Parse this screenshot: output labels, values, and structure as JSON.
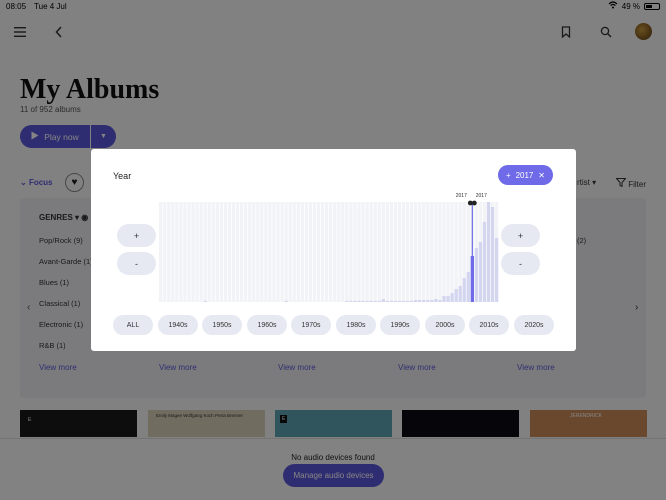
{
  "status": {
    "time": "08:05",
    "date": "Tue 4 Jul",
    "battery": "49 %",
    "battery_level": 0.49
  },
  "page": {
    "title": "My Albums",
    "subtitle": "11 of 952 albums",
    "play_label": "Play now",
    "focus_label": "Focus",
    "artist_label": "rtist",
    "filter_label": "Filter"
  },
  "genres": {
    "header": "GENRES",
    "items": [
      "Pop/Rock (9)",
      "Avant-Garde (1)",
      "Blues (1)",
      "Classical (1)",
      "Electronic (1)",
      "R&B (1)"
    ],
    "view_more": "View more",
    "right_count": "(2)"
  },
  "thumbs": [
    {
      "label": "E",
      "color": "#1a1a1a"
    },
    {
      "label": "Emily Magee  Wolfgang Koch  Petra Brenner",
      "color": "#d8cfb8"
    },
    {
      "label": "E",
      "color": "#5fa4b0"
    },
    {
      "label": "",
      "color": "#0a0a14"
    },
    {
      "label": "JERENDRICK",
      "color": "#c98a58"
    }
  ],
  "footer": {
    "no_audio": "No audio devices found",
    "manage": "Manage audio devices"
  },
  "modal": {
    "title": "Year",
    "chip": "2017",
    "range_start_label": "2017",
    "range_end_label": "2017",
    "plus": "+",
    "minus": "-",
    "decades": [
      "ALL",
      "1940s",
      "1950s",
      "1960s",
      "1970s",
      "1980s",
      "1990s",
      "2000s",
      "2010s",
      "2020s"
    ]
  },
  "chart_data": {
    "type": "bar",
    "x": [
      1940,
      1941,
      1942,
      1943,
      1944,
      1945,
      1946,
      1947,
      1948,
      1949,
      1950,
      1951,
      1952,
      1953,
      1954,
      1955,
      1956,
      1957,
      1958,
      1959,
      1960,
      1961,
      1962,
      1963,
      1964,
      1965,
      1966,
      1967,
      1968,
      1969,
      1970,
      1971,
      1972,
      1973,
      1974,
      1975,
      1976,
      1977,
      1978,
      1979,
      1980,
      1981,
      1982,
      1983,
      1984,
      1985,
      1986,
      1987,
      1988,
      1989,
      1990,
      1991,
      1992,
      1993,
      1994,
      1995,
      1996,
      1997,
      1998,
      1999,
      2000,
      2001,
      2002,
      2003,
      2004,
      2005,
      2006,
      2007,
      2008,
      2009,
      2010,
      2011,
      2012,
      2013,
      2014,
      2015,
      2016,
      2017,
      2018,
      2019,
      2020,
      2021,
      2022,
      2023
    ],
    "values": [
      0,
      0,
      0,
      0,
      0,
      0,
      0,
      0,
      0,
      0,
      0,
      1,
      0,
      0,
      0,
      0,
      0,
      0,
      0,
      0,
      0,
      0,
      0,
      0,
      0,
      0,
      0,
      0,
      0,
      0,
      0,
      1,
      0,
      0,
      0,
      0,
      0,
      0,
      0,
      0,
      0,
      0,
      0,
      0,
      0,
      0,
      1,
      1,
      1,
      1,
      1,
      1,
      1,
      1,
      1,
      3,
      1,
      1,
      1,
      1,
      1,
      1,
      1,
      2,
      2,
      2,
      2,
      2,
      3,
      2,
      6,
      6,
      9,
      13,
      16,
      24,
      30,
      46,
      54,
      60,
      80,
      100,
      95,
      64
    ],
    "highlight": 2017,
    "ylim": [
      0,
      100
    ]
  }
}
